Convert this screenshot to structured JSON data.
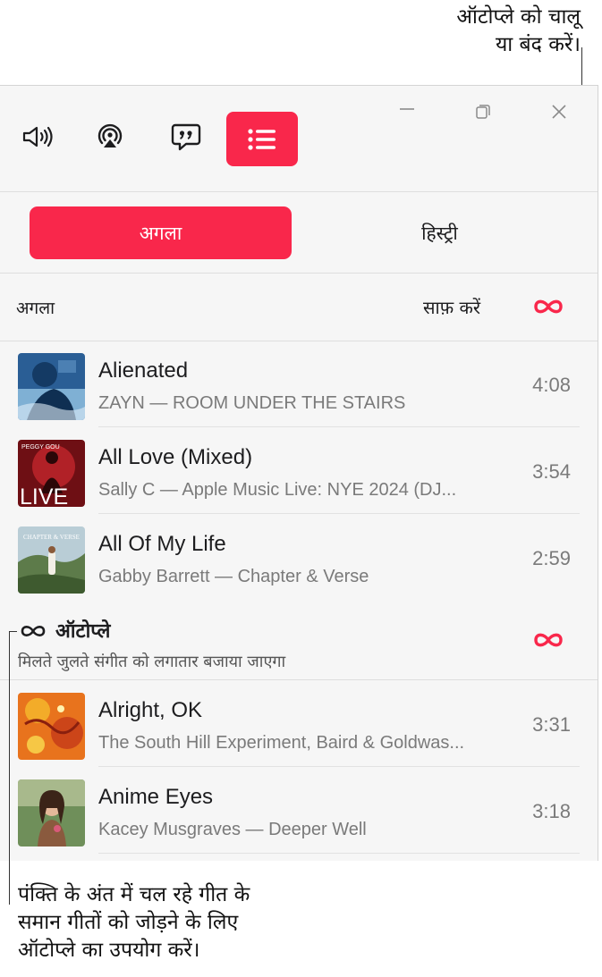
{
  "callouts": {
    "top_line1": "ऑटोप्ले को चालू",
    "top_line2": "या बंद करें।",
    "bottom_line1": "पंक्ति के अंत में चल रहे गीत के",
    "bottom_line2": "समान गीतों को जोड़ने के लिए",
    "bottom_line3": "ऑटोप्ले का उपयोग करें।"
  },
  "window_controls": {
    "minimize_icon": "minimize-icon",
    "restore_icon": "restore-icon",
    "close_icon": "close-icon"
  },
  "toolbar": {
    "volume_icon": "speaker-volume-icon",
    "airplay_icon": "airplay-icon",
    "lyrics_icon": "lyrics-quote-icon",
    "queue_icon": "queue-list-icon"
  },
  "tabs": [
    {
      "label": "अगला",
      "selected": true
    },
    {
      "label": "हिस्ट्री",
      "selected": false
    }
  ],
  "up_next": {
    "heading": "अगला",
    "clear_label": "साफ़ करें",
    "autoplay_toggle_icon": "infinity-icon",
    "items": [
      {
        "title": "Alienated",
        "subtitle": "ZAYN — ROOM UNDER THE STAIRS",
        "duration": "4:08"
      },
      {
        "title": "All Love (Mixed)",
        "subtitle": "Sally C — Apple Music Live: NYE 2024 (DJ...",
        "duration": "3:54",
        "art_text": "LIVE",
        "art_badge": "PEGGY GOU"
      },
      {
        "title": "All Of My Life",
        "subtitle": "Gabby Barrett — Chapter & Verse",
        "duration": "2:59",
        "art_text": "CHAPTER & VERSE"
      }
    ]
  },
  "autoplay": {
    "title": "ऑटोप्ले",
    "subtitle": "मिलते जुलते संगीत को लगातार बजाया जाएगा",
    "items": [
      {
        "title": "Alright, OK",
        "subtitle": "The South Hill Experiment, Baird & Goldwas...",
        "duration": "3:31"
      },
      {
        "title": "Anime Eyes",
        "subtitle": "Kacey Musgraves — Deeper Well",
        "duration": "3:18"
      }
    ]
  },
  "colors": {
    "accent": "#f9274b",
    "panel_bg": "#f6f6f6",
    "secondary_text": "#7a7a7a"
  }
}
